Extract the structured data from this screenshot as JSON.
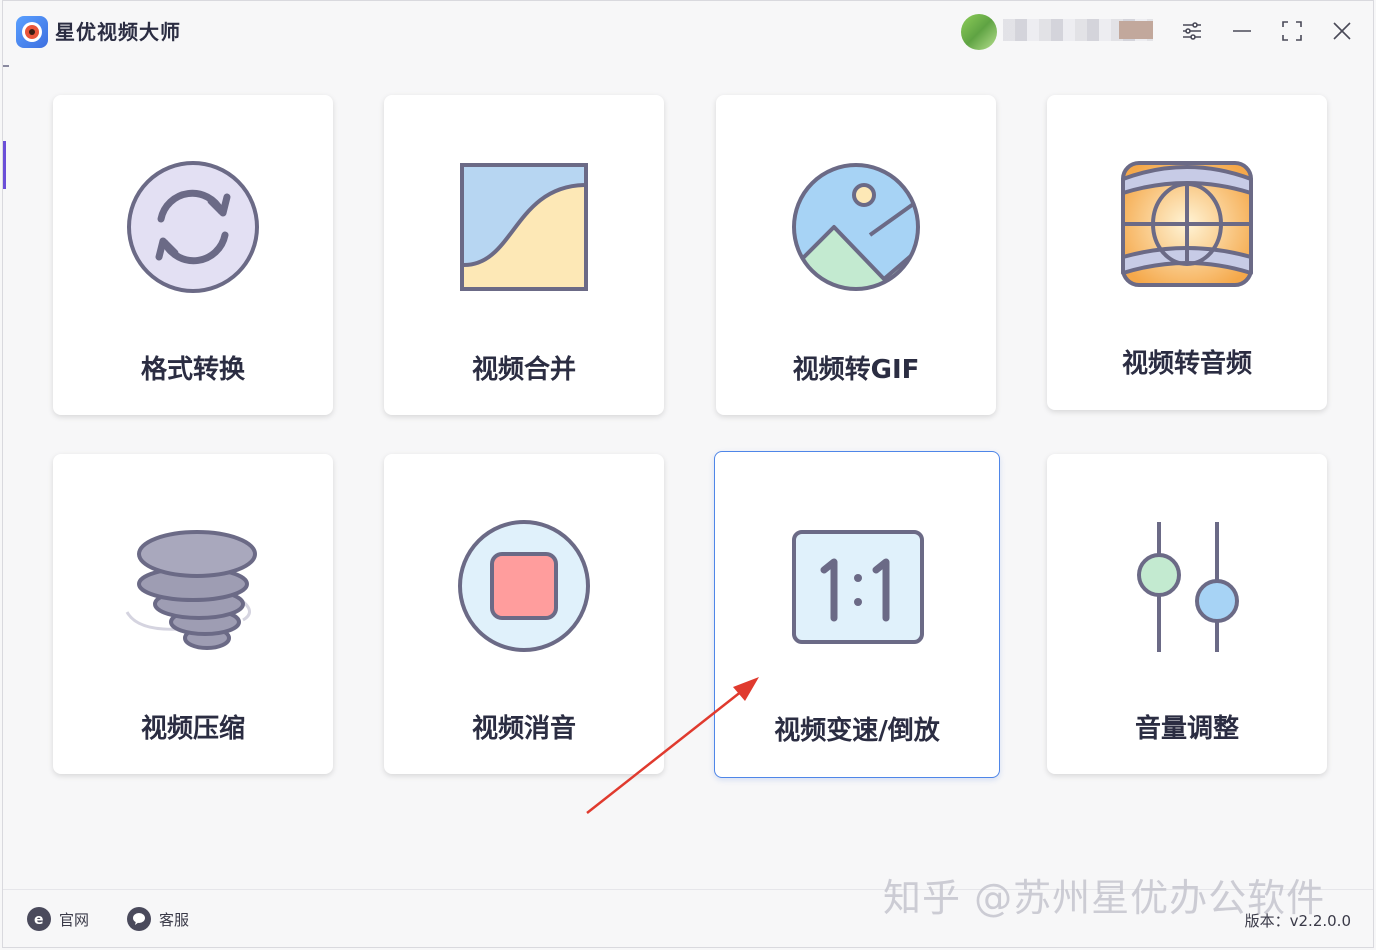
{
  "app": {
    "title": "星优视频大师"
  },
  "titlebar": {
    "settings_icon": "sliders-icon",
    "minimize_icon": "minimize-icon",
    "maximize_icon": "maximize-icon",
    "close_icon": "close-icon"
  },
  "cards": [
    {
      "label": "格式转换",
      "icon": "convert-icon"
    },
    {
      "label": "视频合并",
      "icon": "merge-icon"
    },
    {
      "label": "视频转GIF",
      "icon": "image-icon"
    },
    {
      "label": "视频转音频",
      "icon": "globe-audio-icon"
    },
    {
      "label": "视频压缩",
      "icon": "tornado-icon"
    },
    {
      "label": "视频消音",
      "icon": "stop-icon"
    },
    {
      "label": "视频变速/倒放",
      "icon": "ratio-icon",
      "selected": true
    },
    {
      "label": "音量调整",
      "icon": "volume-sliders-icon"
    }
  ],
  "footer": {
    "website_label": "官网",
    "support_label": "客服",
    "version": "版本：v2.2.0.0",
    "watermark": "知乎 @苏州星优办公软件"
  },
  "colors": {
    "accent": "#4f86e8",
    "arrow": "#e03a2e",
    "icon_stroke": "#6b6a86"
  }
}
